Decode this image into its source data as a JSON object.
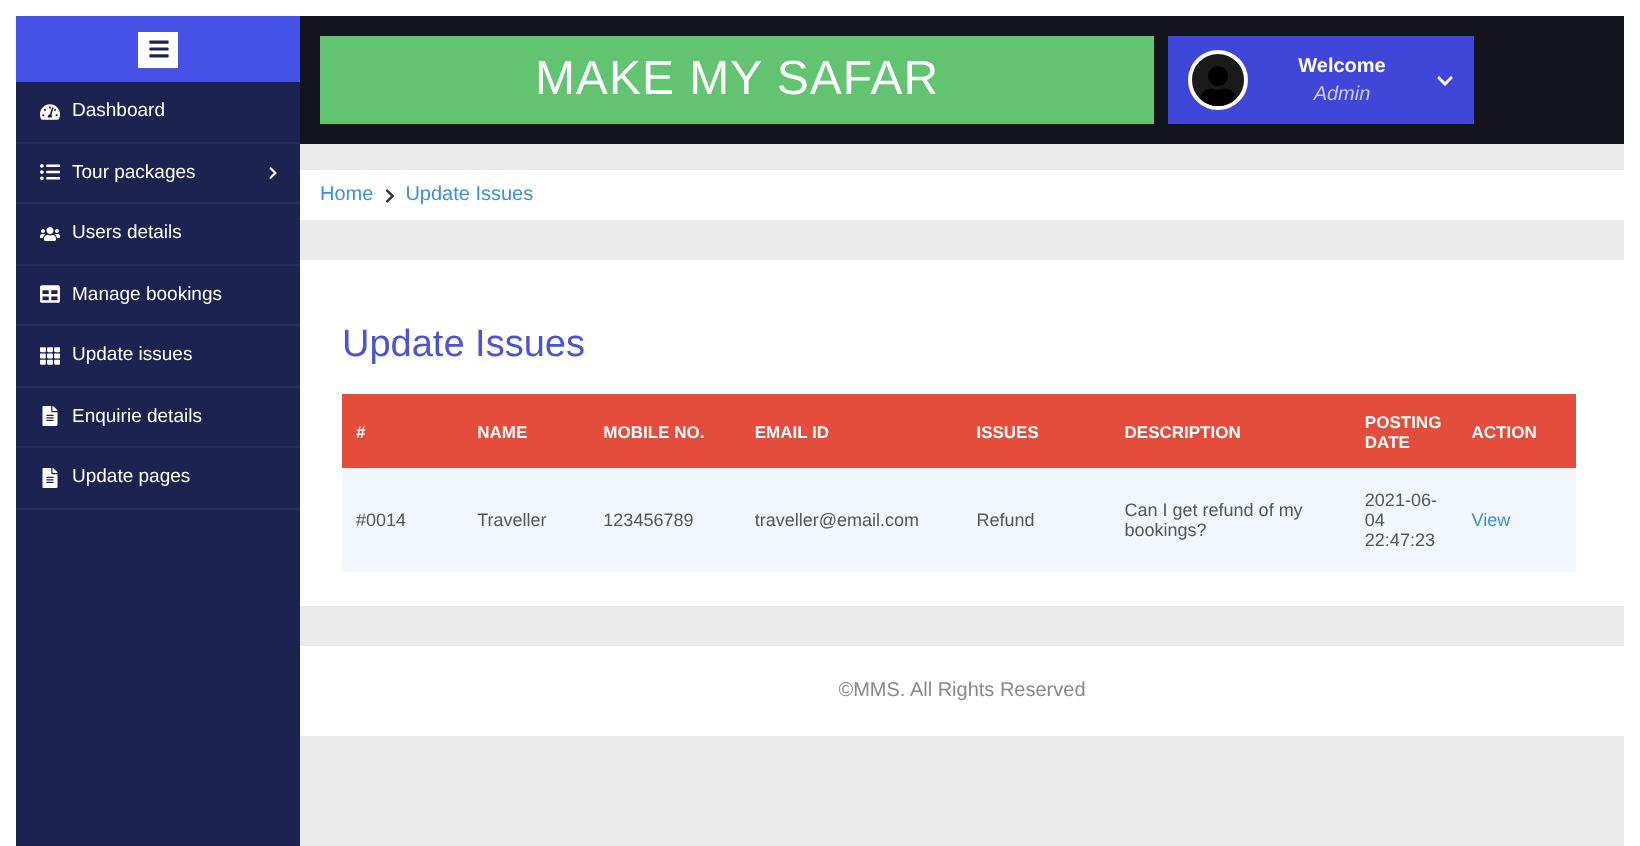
{
  "sidebar": {
    "items": [
      {
        "label": "Dashboard",
        "expandable": false
      },
      {
        "label": "Tour packages",
        "expandable": true
      },
      {
        "label": "Users details",
        "expandable": false
      },
      {
        "label": "Manage bookings",
        "expandable": false
      },
      {
        "label": "Update issues",
        "expandable": false
      },
      {
        "label": "Enquirie details",
        "expandable": false
      },
      {
        "label": "Update pages",
        "expandable": false
      }
    ]
  },
  "header": {
    "brand": "MAKE MY SAFAR",
    "user": {
      "greeting": "Welcome",
      "role": "Admin"
    }
  },
  "breadcrumb": [
    {
      "label": "Home"
    },
    {
      "label": "Update Issues"
    }
  ],
  "page_title": "Update Issues",
  "table": {
    "columns": [
      "#",
      "NAME",
      "MOBILE NO.",
      "EMAIL ID",
      "ISSUES",
      "DESCRIPTION",
      "POSTING DATE",
      "ACTION"
    ],
    "rows": [
      [
        "#0014",
        "Traveller",
        "123456789",
        "traveller@email.com",
        "Refund",
        "Can I get refund of my bookings?",
        "2021-06-04 22:47:23",
        "View"
      ]
    ]
  },
  "footer": "©MMS. All Rights Reserved"
}
